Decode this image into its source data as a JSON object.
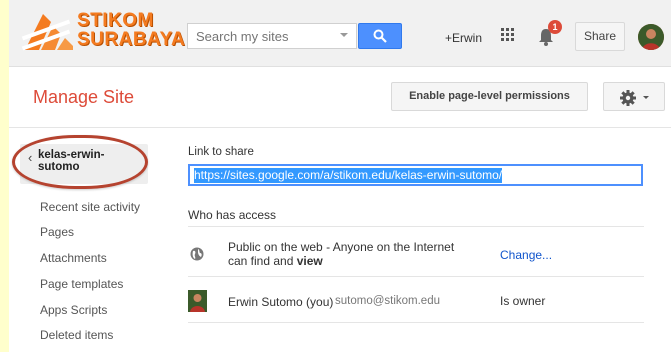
{
  "header": {
    "logo_line1": "STIKOM",
    "logo_line2": "SURABAYA",
    "search_placeholder": "Search my sites",
    "user_link": "+Erwin",
    "notification_count": "1",
    "share_label": "Share"
  },
  "title_bar": {
    "title": "Manage Site",
    "permissions_button": "Enable page-level permissions"
  },
  "sidebar": {
    "site_name": "kelas-erwin-sutomo",
    "items": [
      {
        "label": "Recent site activity"
      },
      {
        "label": "Pages"
      },
      {
        "label": "Attachments"
      },
      {
        "label": "Page templates"
      },
      {
        "label": "Apps Scripts"
      },
      {
        "label": "Deleted items"
      }
    ]
  },
  "sharing": {
    "link_label": "Link to share",
    "link_url": "https://sites.google.com/a/stikom.edu/kelas-erwin-sutomo/",
    "access_heading": "Who has access",
    "public_text_prefix": "Public on the web - Anyone on the Internet can find and ",
    "public_text_bold": "view",
    "change_link": "Change...",
    "owner_name": "Erwin Sutomo (you)",
    "owner_email": "sutomo@stikom.edu",
    "owner_role": "Is owner"
  },
  "colors": {
    "accent_red": "#dd4b39",
    "search_blue": "#4d90fe",
    "logo_orange": "#f47b20",
    "highlight_oval": "#b5432f",
    "link_blue": "#1155cc"
  }
}
